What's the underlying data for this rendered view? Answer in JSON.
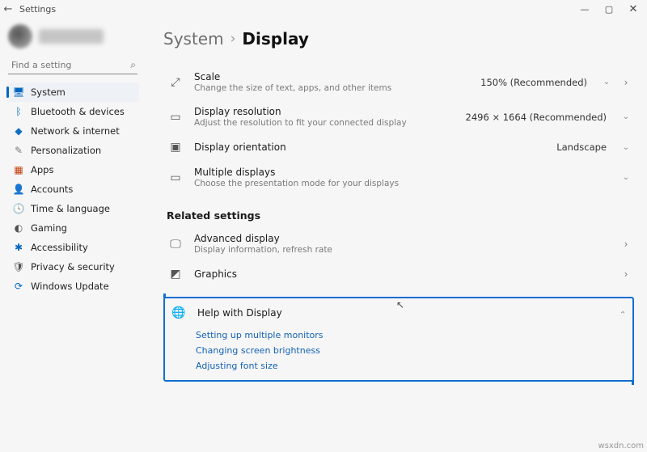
{
  "window": {
    "title": "Settings"
  },
  "search": {
    "placeholder": "Find a setting"
  },
  "sidebar": {
    "items": [
      {
        "icon": "system-icon",
        "label": "System",
        "selected": true
      },
      {
        "icon": "bluetooth-icon",
        "label": "Bluetooth & devices",
        "selected": false
      },
      {
        "icon": "network-icon",
        "label": "Network & internet",
        "selected": false
      },
      {
        "icon": "personalization-icon",
        "label": "Personalization",
        "selected": false
      },
      {
        "icon": "apps-icon",
        "label": "Apps",
        "selected": false
      },
      {
        "icon": "accounts-icon",
        "label": "Accounts",
        "selected": false
      },
      {
        "icon": "time-icon",
        "label": "Time & language",
        "selected": false
      },
      {
        "icon": "gaming-icon",
        "label": "Gaming",
        "selected": false
      },
      {
        "icon": "accessibility-icon",
        "label": "Accessibility",
        "selected": false
      },
      {
        "icon": "privacy-icon",
        "label": "Privacy & security",
        "selected": false
      },
      {
        "icon": "update-icon",
        "label": "Windows Update",
        "selected": false
      }
    ]
  },
  "breadcrumb": {
    "parent": "System",
    "current": "Display"
  },
  "settings": {
    "scale": {
      "title": "Scale",
      "subtitle": "Change the size of text, apps, and other items",
      "value": "150% (Recommended)"
    },
    "resolution": {
      "title": "Display resolution",
      "subtitle": "Adjust the resolution to fit your connected display",
      "value": "2496 × 1664 (Recommended)"
    },
    "orientation": {
      "title": "Display orientation",
      "value": "Landscape"
    },
    "multiple": {
      "title": "Multiple displays",
      "subtitle": "Choose the presentation mode for your displays"
    }
  },
  "related": {
    "header": "Related settings",
    "advanced": {
      "title": "Advanced display",
      "subtitle": "Display information, refresh rate"
    },
    "graphics": {
      "title": "Graphics"
    }
  },
  "help": {
    "title": "Help with Display",
    "links": [
      "Setting up multiple monitors",
      "Changing screen brightness",
      "Adjusting font size"
    ]
  },
  "watermark": "wsxdn.com"
}
